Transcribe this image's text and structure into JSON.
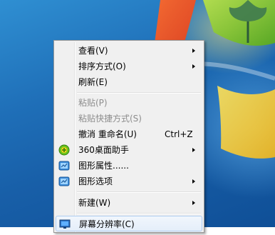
{
  "context_menu": {
    "items": [
      {
        "label": "查看(V)",
        "submenu": true,
        "enabled": true
      },
      {
        "label": "排序方式(O)",
        "submenu": true,
        "enabled": true
      },
      {
        "label": "刷新(E)",
        "submenu": false,
        "enabled": true
      },
      {
        "label": "粘贴(P)",
        "submenu": false,
        "enabled": false
      },
      {
        "label": "粘贴快捷方式(S)",
        "submenu": false,
        "enabled": false
      },
      {
        "label": "撤消 重命名(U)",
        "shortcut": "Ctrl+Z",
        "submenu": false,
        "enabled": true
      },
      {
        "label": "360桌面助手",
        "icon": "360-assistant-icon",
        "submenu": true,
        "enabled": true
      },
      {
        "label": "图形属性......",
        "icon": "graphics-properties-icon",
        "submenu": false,
        "enabled": true
      },
      {
        "label": "图形选项",
        "icon": "graphics-options-icon",
        "submenu": true,
        "enabled": true
      },
      {
        "label": "新建(W)",
        "submenu": true,
        "enabled": true
      },
      {
        "label": "屏幕分辨率(C)",
        "icon": "screen-resolution-icon",
        "submenu": false,
        "enabled": true
      }
    ]
  },
  "colors": {
    "menu_background": "#f0f0f0",
    "menu_border": "#979797",
    "desktop_blue": "#1f6fb8",
    "disabled_text": "#8d8d8d"
  }
}
